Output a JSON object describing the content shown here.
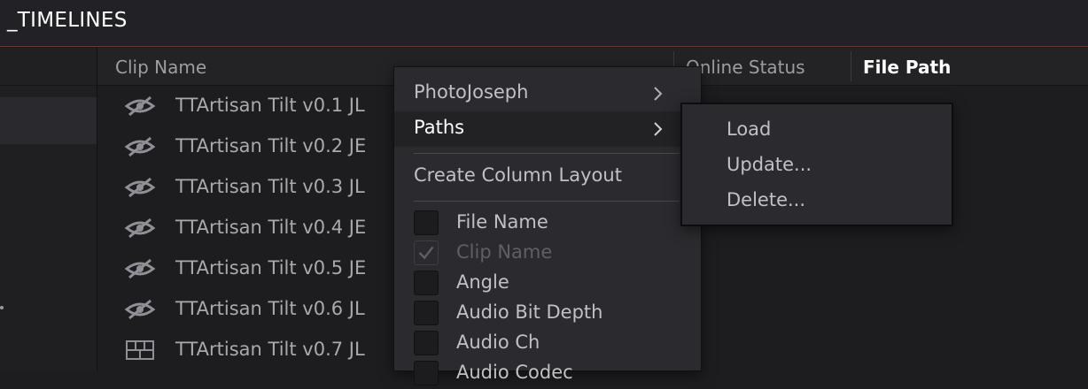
{
  "header": {
    "title": "_TIMELINES"
  },
  "columns": {
    "clip_name": "Clip Name",
    "online_status": "Online Status",
    "file_path": "File Path"
  },
  "clips": [
    {
      "name": "TTArtisan Tilt v0.1 JL",
      "icon": "hidden-eye-icon"
    },
    {
      "name": "TTArtisan Tilt v0.2 JE",
      "icon": "hidden-eye-icon"
    },
    {
      "name": "TTArtisan Tilt v0.3 JL",
      "icon": "hidden-eye-icon"
    },
    {
      "name": "TTArtisan Tilt v0.4 JE",
      "icon": "hidden-eye-icon"
    },
    {
      "name": "TTArtisan Tilt v0.5 JE",
      "icon": "hidden-eye-icon"
    },
    {
      "name": "TTArtisan Tilt v0.6 JL",
      "icon": "hidden-eye-icon"
    },
    {
      "name": "TTArtisan Tilt v0.7 JL",
      "icon": "timeline-icon"
    }
  ],
  "context_menu": {
    "items": [
      {
        "label": "PhotoJoseph",
        "submenu": true
      },
      {
        "label": "Paths",
        "submenu": true
      }
    ],
    "create_layout": "Create Column Layout",
    "checkboxes": [
      {
        "label": "File Name",
        "checked": false,
        "disabled": false
      },
      {
        "label": "Clip Name",
        "checked": true,
        "disabled": true
      },
      {
        "label": "Angle",
        "checked": false,
        "disabled": false
      },
      {
        "label": "Audio Bit Depth",
        "checked": false,
        "disabled": false
      },
      {
        "label": "Audio Ch",
        "checked": false,
        "disabled": false
      },
      {
        "label": "Audio Codec",
        "checked": false,
        "disabled": false
      }
    ]
  },
  "submenu": {
    "items": [
      "Load",
      "Update...",
      "Delete..."
    ]
  },
  "colors": {
    "accent_line": "#8a2a2a",
    "background": "#1d1d20",
    "menu_bg": "#2b2b2f"
  }
}
